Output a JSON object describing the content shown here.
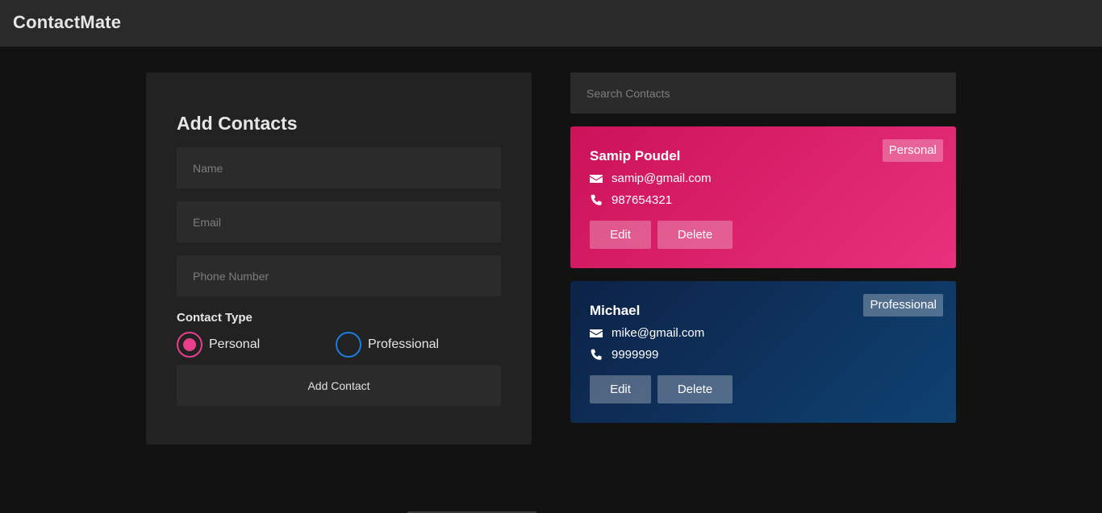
{
  "navbar": {
    "brand": "ContactMate"
  },
  "form": {
    "title": "Add Contacts",
    "name_placeholder": "Name",
    "email_placeholder": "Email",
    "phone_placeholder": "Phone Number",
    "contact_type_label": "Contact Type",
    "options": [
      {
        "label": "Personal",
        "selected": true
      },
      {
        "label": "Professional",
        "selected": false
      }
    ],
    "submit_label": "Add Contact"
  },
  "search": {
    "placeholder": "Search Contacts"
  },
  "contacts": [
    {
      "name": "Samip Poudel",
      "email": "samip@gmail.com",
      "phone": "987654321",
      "type": "Personal",
      "edit_label": "Edit",
      "delete_label": "Delete"
    },
    {
      "name": "Michael",
      "email": "mike@gmail.com",
      "phone": "9999999",
      "type": "Professional",
      "edit_label": "Edit",
      "delete_label": "Delete"
    }
  ],
  "colors": {
    "background": "#121212",
    "navbar": "#2a2a2a",
    "panel": "#222222",
    "personal_accent": "#e83e8c",
    "professional_accent": "#1e7ae6",
    "personal_card_start": "#cc1259",
    "personal_card_end": "#e8307c",
    "professional_card_start": "#0d2247",
    "professional_card_end": "#0f4272"
  },
  "icons": {
    "email": "envelope-icon",
    "phone": "phone-icon"
  }
}
